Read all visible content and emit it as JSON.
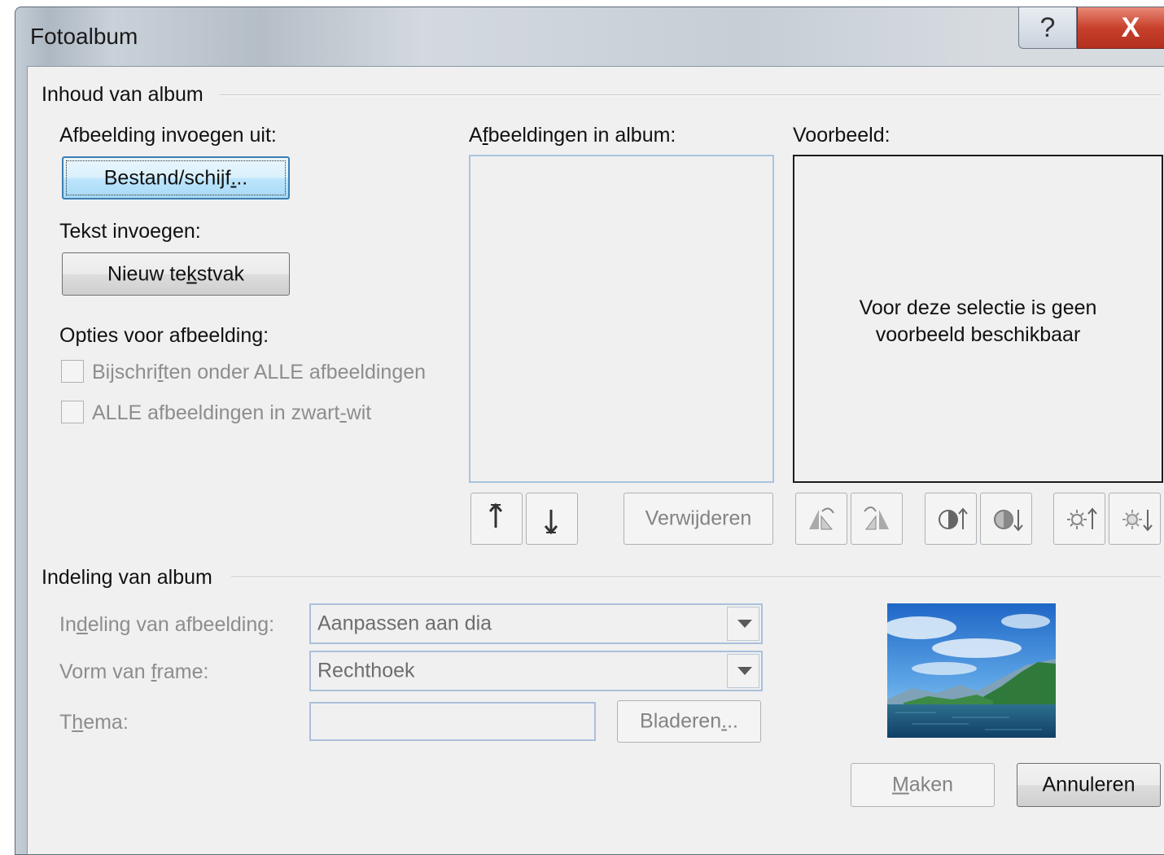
{
  "window": {
    "title": "Fotoalbum",
    "help_label": "?",
    "close_label": "X"
  },
  "content": {
    "group_title": "Inhoud van album",
    "insert_picture_from": "Afbeelding invoegen uit:",
    "file_disk_button": {
      "before": "Bestand/schijf",
      "accel": ".",
      "after": ".."
    },
    "insert_text": "Tekst invoegen:",
    "new_textbox_button": {
      "before": "Nieuw te",
      "accel": "k",
      "after": "stvak"
    },
    "picture_options": "Opties voor afbeelding:",
    "captions_checkbox": {
      "before": "Bijschri",
      "accel": "f",
      "after": "ten onder ALLE afbeeldingen",
      "checked": false
    },
    "bw_checkbox": {
      "before": "ALLE afbeeldingen in zwart",
      "accel": "-",
      "after": "wit",
      "checked": false
    },
    "pictures_in_album": {
      "before": "A",
      "accel": "f",
      "after": "beeldingen in album:"
    },
    "remove_button": {
      "before": "Verwi",
      "accel": "j",
      "after": "deren"
    },
    "preview_label": "Voorbeeld:",
    "preview_message_line1": "Voor deze selectie is geen",
    "preview_message_line2": "voorbeeld beschikbaar"
  },
  "layout": {
    "group_title": "Indeling van album",
    "picture_layout_label": {
      "before": "In",
      "accel": "d",
      "after": "eling van afbeelding:"
    },
    "picture_layout_value": "Aanpassen aan dia",
    "frame_shape_label": {
      "before": "Vorm van ",
      "accel": "f",
      "after": "rame:"
    },
    "frame_shape_value": "Rechthoek",
    "theme_label": {
      "before": "T",
      "accel": "h",
      "after": "ema:"
    },
    "theme_value": "",
    "browse_button": {
      "before": "Bladeren",
      "accel": ".",
      "after": ".."
    }
  },
  "footer": {
    "create_button": {
      "before": "",
      "accel": "M",
      "after": "aken"
    },
    "cancel_button": "Annuleren"
  },
  "icons": {
    "move_up": "arrow-up-icon",
    "move_down": "arrow-down-icon",
    "rotate_left": "rotate-left-icon",
    "rotate_right": "rotate-right-icon",
    "contrast_up": "contrast-up-icon",
    "contrast_down": "contrast-down-icon",
    "brightness_up": "brightness-up-icon",
    "brightness_down": "brightness-down-icon"
  },
  "colors": {
    "close_button": "#c8412c",
    "focus_border": "#3c7fb1"
  }
}
